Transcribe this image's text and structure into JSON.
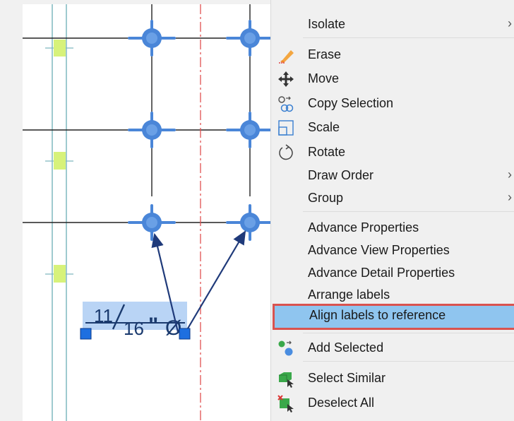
{
  "canvas": {
    "dimension_label": {
      "numerator": "11",
      "denominator": "16",
      "suffix": "\"",
      "diameter_symbol": "Ø"
    }
  },
  "context_menu": {
    "items": [
      {
        "id": "isolate",
        "label": "Isolate",
        "submenu_arrow": "›"
      },
      {
        "id": "erase",
        "label": "Erase",
        "icon": "eraser-icon"
      },
      {
        "id": "move",
        "label": "Move",
        "icon": "move-icon"
      },
      {
        "id": "copy_selection",
        "label": "Copy Selection",
        "icon": "copy-selection-icon"
      },
      {
        "id": "scale",
        "label": "Scale",
        "icon": "scale-icon"
      },
      {
        "id": "rotate",
        "label": "Rotate",
        "icon": "rotate-icon"
      },
      {
        "id": "draw_order",
        "label": "Draw Order",
        "submenu_arrow": "›"
      },
      {
        "id": "group",
        "label": "Group",
        "submenu_arrow": "›"
      },
      {
        "id": "advance_properties",
        "label": "Advance Properties"
      },
      {
        "id": "advance_view_properties",
        "label": "Advance View Properties"
      },
      {
        "id": "advance_detail_properties",
        "label": "Advance Detail Properties"
      },
      {
        "id": "arrange_labels",
        "label": "Arrange labels"
      },
      {
        "id": "align_labels",
        "label": "Align labels to reference",
        "highlighted": true
      },
      {
        "id": "add_selected",
        "label": "Add Selected",
        "icon": "add-selected-icon"
      },
      {
        "id": "select_similar",
        "label": "Select Similar",
        "icon": "select-similar-icon"
      },
      {
        "id": "deselect_all",
        "label": "Deselect All",
        "icon": "deselect-all-icon"
      }
    ]
  },
  "colors": {
    "highlight_fill": "#8fc5ef",
    "highlight_border": "#d9534f",
    "node_blue": "#4a86d8",
    "leader_navy": "#1f3a7a",
    "centerline_red": "#e05050",
    "hanger_green": "#d7f27a",
    "pipe_teal": "#7fb8bf"
  }
}
